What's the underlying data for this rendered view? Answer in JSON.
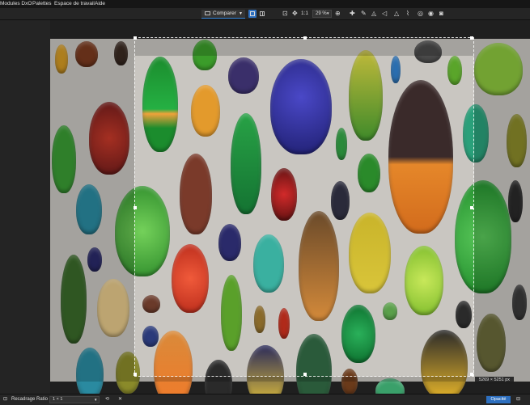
{
  "menubar": {
    "items": [
      "Modules DxO",
      "Palettes",
      "Espace de travail",
      "Aide"
    ]
  },
  "toolbar": {
    "compare_label": "Comparer",
    "one_to_one_label": "1:1",
    "zoom_value": "29 %",
    "icons": [
      "single-view-icon",
      "split-view-icon",
      "crop-icon",
      "move-icon",
      "zoom-fit-icon",
      "color-picker-icon",
      "white-balance-icon",
      "horizon-icon",
      "perspective-icon",
      "ruler-icon",
      "repair-icon",
      "eye-icon",
      "mask-icon"
    ]
  },
  "canvas": {
    "crop_dimensions": "5269 × 5251 px"
  },
  "statusbar": {
    "crop_label": "Recadrage",
    "ratio_label": "Ratio",
    "ratio_value": "1 × 1",
    "opacity_label": "Opacité"
  },
  "colors": {
    "accent": "#2d7fd3",
    "background": "#1b1b1b"
  }
}
